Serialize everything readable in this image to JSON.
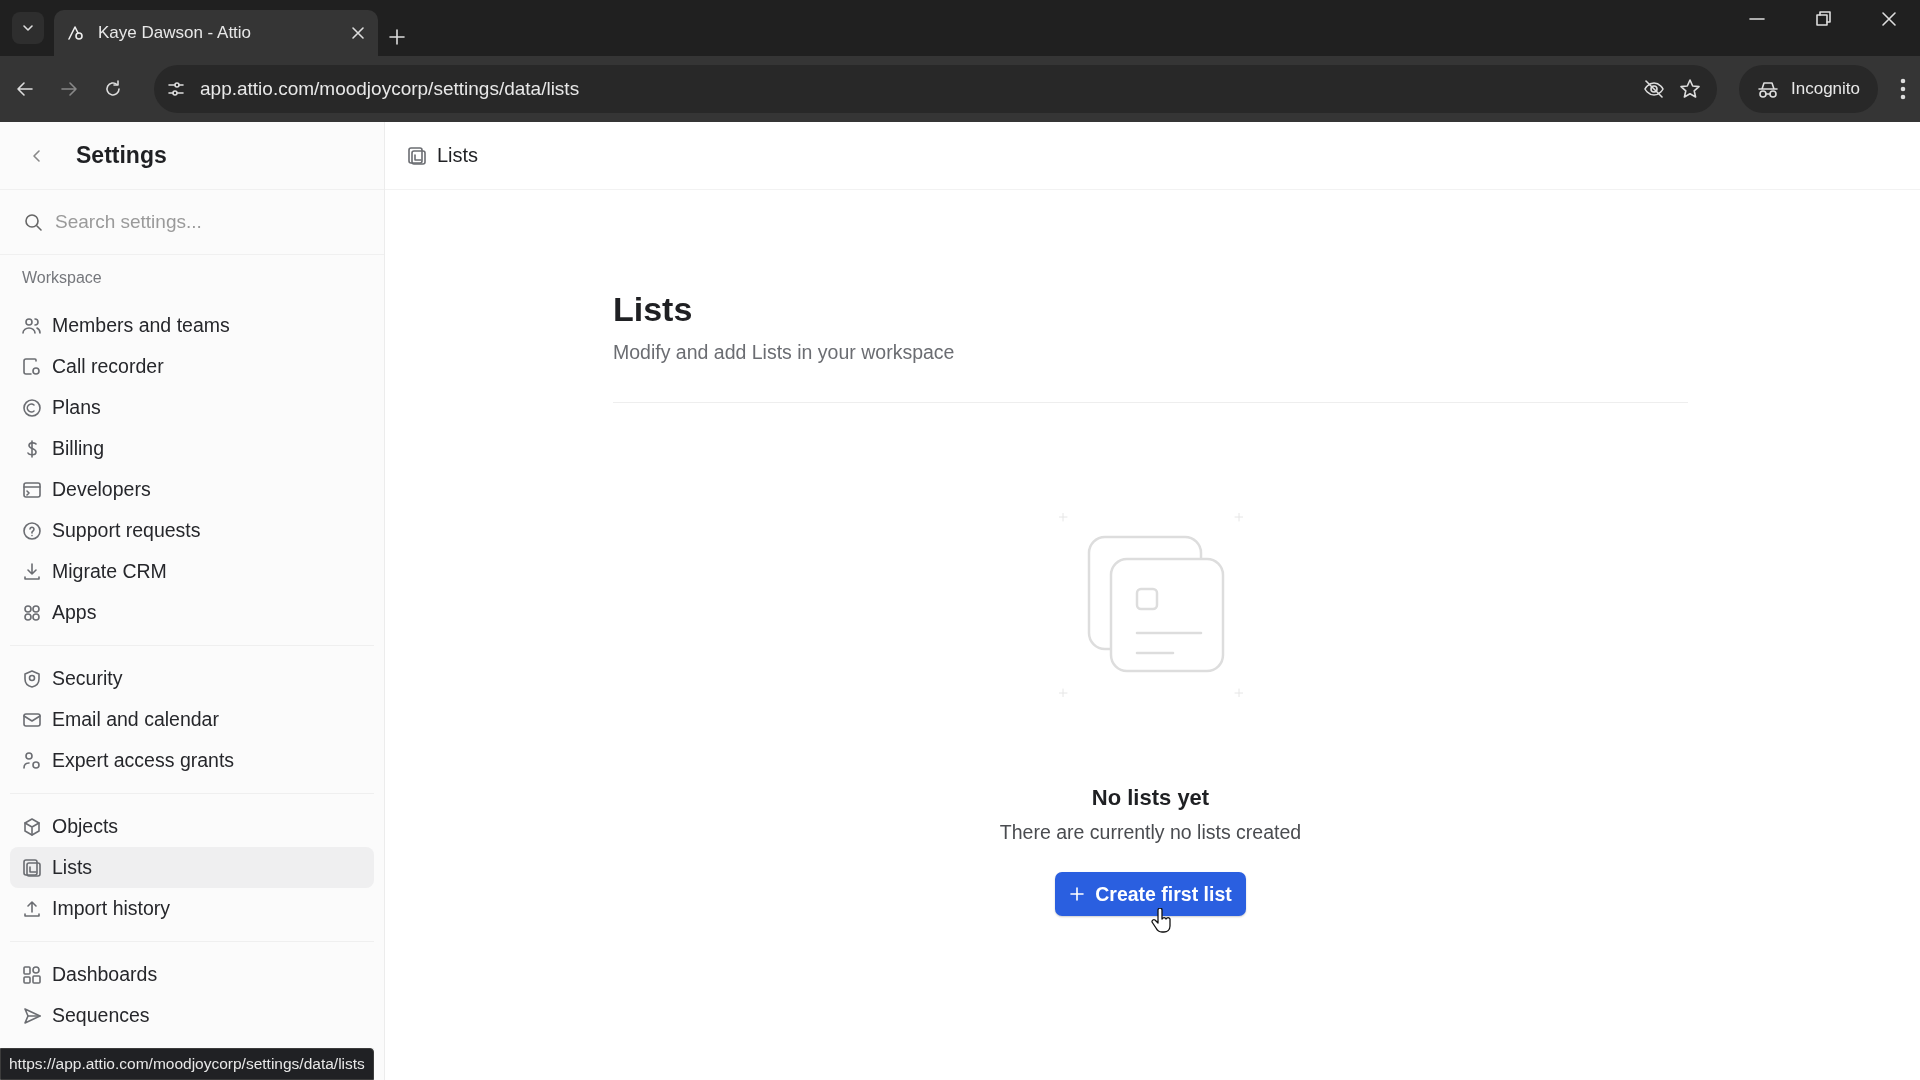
{
  "browser": {
    "tab_title": "Kaye Dawson - Attio",
    "url": "app.attio.com/moodjoycorp/settings/data/lists",
    "profile": "Incognito"
  },
  "sidebar": {
    "title": "Settings",
    "search": {
      "placeholder": "Search settings..."
    },
    "groups": [
      {
        "heading": "Workspace",
        "items": [
          {
            "label": "Members and teams",
            "selected": false
          },
          {
            "label": "Call recorder",
            "selected": false
          },
          {
            "label": "Plans",
            "selected": false
          },
          {
            "label": "Billing",
            "selected": false
          },
          {
            "label": "Developers",
            "selected": false
          },
          {
            "label": "Support requests",
            "selected": false
          },
          {
            "label": "Migrate CRM",
            "selected": false
          },
          {
            "label": "Apps",
            "selected": false
          }
        ]
      },
      {
        "items": [
          {
            "label": "Security",
            "selected": false
          },
          {
            "label": "Email and calendar",
            "selected": false
          },
          {
            "label": "Expert access grants",
            "selected": false
          }
        ]
      },
      {
        "items": [
          {
            "label": "Objects",
            "selected": false
          },
          {
            "label": "Lists",
            "selected": true
          },
          {
            "label": "Import history",
            "selected": false
          }
        ]
      },
      {
        "items": [
          {
            "label": "Dashboards",
            "selected": false
          },
          {
            "label": "Sequences",
            "selected": false
          }
        ]
      }
    ]
  },
  "header": {
    "title": "Lists"
  },
  "page": {
    "title": "Lists",
    "subtitle": "Modify and add Lists in your workspace",
    "empty_state": {
      "title": "No lists yet",
      "message": "There are currently no lists created",
      "button": "Create first list"
    }
  },
  "status_url": "https://app.attio.com/moodjoycorp/settings/data/lists"
}
